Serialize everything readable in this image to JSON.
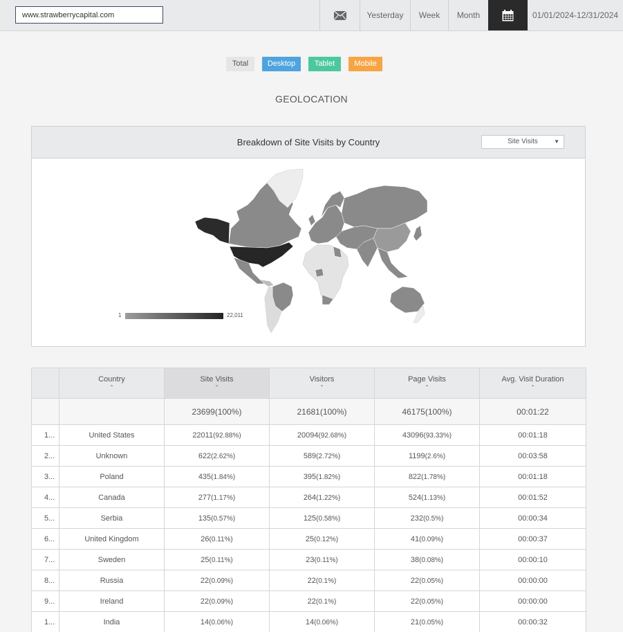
{
  "topbar": {
    "url": "www.strawberrycapital.com",
    "mail_icon": "envelope-icon",
    "periods": [
      "Yesterday",
      "Week",
      "Month"
    ],
    "calendar_icon": "calendar-icon",
    "date_range": "01/01/2024-12/31/2024"
  },
  "devices": {
    "total": "Total",
    "desktop": "Desktop",
    "tablet": "Tablet",
    "mobile": "Mobile",
    "colors": {
      "desktop": "#4ea4dd",
      "tablet": "#4cc8a0",
      "mobile": "#f6a545"
    }
  },
  "section_title": "GEOLOCATION",
  "map": {
    "title": "Breakdown of Site Visits by Country",
    "metric_selected": "Site Visits",
    "legend_min": "1",
    "legend_max": "22,011"
  },
  "table": {
    "columns": [
      "Country",
      "Site Visits",
      "Visitors",
      "Page Visits",
      "Avg. Visit Duration"
    ],
    "sorted_column": "Site Visits",
    "totals": {
      "site_visits": "23699(100%)",
      "visitors": "21681(100%)",
      "page_visits": "46175(100%)",
      "duration": "00:01:22"
    },
    "rows": [
      {
        "rank": "1...",
        "country": "United States",
        "sv": "22011",
        "sv_pct": "(92.88%)",
        "vi": "20094",
        "vi_pct": "(92.68%)",
        "pv": "43096",
        "pv_pct": "(93.33%)",
        "dur": "00:01:18"
      },
      {
        "rank": "2...",
        "country": "Unknown",
        "sv": "622",
        "sv_pct": "(2.62%)",
        "vi": "589",
        "vi_pct": "(2.72%)",
        "pv": "1199",
        "pv_pct": "(2.6%)",
        "dur": "00:03:58"
      },
      {
        "rank": "3...",
        "country": "Poland",
        "sv": "435",
        "sv_pct": "(1.84%)",
        "vi": "395",
        "vi_pct": "(1.82%)",
        "pv": "822",
        "pv_pct": "(1.78%)",
        "dur": "00:01:18"
      },
      {
        "rank": "4...",
        "country": "Canada",
        "sv": "277",
        "sv_pct": "(1.17%)",
        "vi": "264",
        "vi_pct": "(1.22%)",
        "pv": "524",
        "pv_pct": "(1.13%)",
        "dur": "00:01:52"
      },
      {
        "rank": "5...",
        "country": "Serbia",
        "sv": "135",
        "sv_pct": "(0.57%)",
        "vi": "125",
        "vi_pct": "(0.58%)",
        "pv": "232",
        "pv_pct": "(0.5%)",
        "dur": "00:00:34"
      },
      {
        "rank": "6...",
        "country": "United Kingdom",
        "sv": "26",
        "sv_pct": "(0.11%)",
        "vi": "25",
        "vi_pct": "(0.12%)",
        "pv": "41",
        "pv_pct": "(0.09%)",
        "dur": "00:00:37"
      },
      {
        "rank": "7...",
        "country": "Sweden",
        "sv": "25",
        "sv_pct": "(0.11%)",
        "vi": "23",
        "vi_pct": "(0.11%)",
        "pv": "38",
        "pv_pct": "(0.08%)",
        "dur": "00:00:10"
      },
      {
        "rank": "8...",
        "country": "Russia",
        "sv": "22",
        "sv_pct": "(0.09%)",
        "vi": "22",
        "vi_pct": "(0.1%)",
        "pv": "22",
        "pv_pct": "(0.05%)",
        "dur": "00:00:00"
      },
      {
        "rank": "9...",
        "country": "Ireland",
        "sv": "22",
        "sv_pct": "(0.09%)",
        "vi": "22",
        "vi_pct": "(0.1%)",
        "pv": "22",
        "pv_pct": "(0.05%)",
        "dur": "00:00:00"
      },
      {
        "rank": "1...",
        "country": "India",
        "sv": "14",
        "sv_pct": "(0.06%)",
        "vi": "14",
        "vi_pct": "(0.06%)",
        "pv": "21",
        "pv_pct": "(0.05%)",
        "dur": "00:00:32"
      }
    ]
  }
}
